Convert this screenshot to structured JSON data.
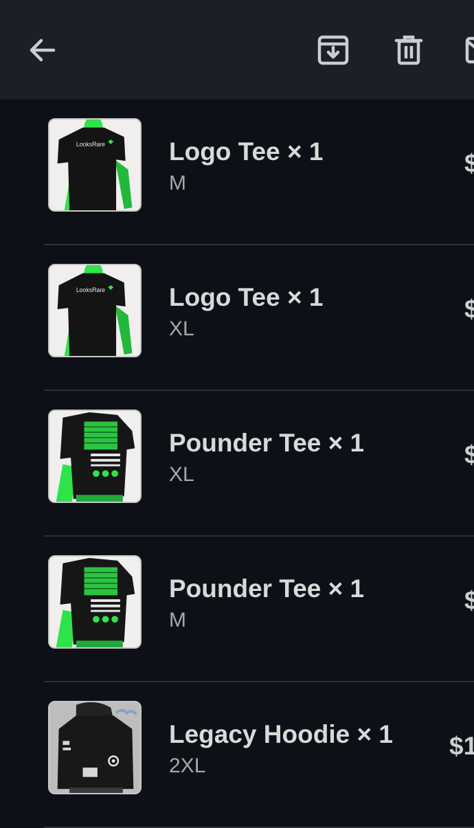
{
  "toolbar": {
    "back_icon": "arrow-left-icon",
    "archive_icon": "archive-download-icon",
    "delete_icon": "trash-icon",
    "mail_icon": "mail-icon"
  },
  "items": [
    {
      "title": "Logo Tee × 1",
      "size": "M",
      "price": "$",
      "image": "logo-tee"
    },
    {
      "title": "Logo Tee × 1",
      "size": "XL",
      "price": "$",
      "image": "logo-tee"
    },
    {
      "title": "Pounder Tee × 1",
      "size": "XL",
      "price": "$",
      "image": "pounder-tee"
    },
    {
      "title": "Pounder Tee × 1",
      "size": "M",
      "price": "$",
      "image": "pounder-tee"
    },
    {
      "title": "Legacy Hoodie × 1",
      "size": "2XL",
      "price": "$1",
      "image": "legacy-hoodie"
    }
  ],
  "brand_text": "LooksRare",
  "colors": {
    "background": "#0d1117",
    "toolbar": "#1b1f26",
    "accent_green": "#2fe34a"
  }
}
